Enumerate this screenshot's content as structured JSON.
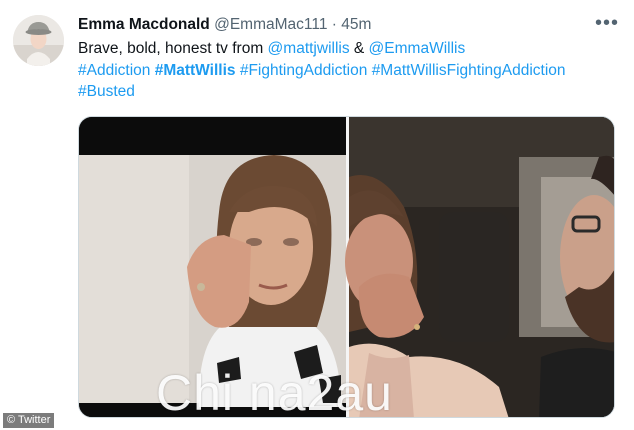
{
  "tweet": {
    "author_name": "Emma Macdonald",
    "author_handle": "@EmmaMac111",
    "separator": "·",
    "time": "45m",
    "more_glyph": "•••",
    "text_intro": "Brave, bold, honest tv from ",
    "mention_1": "@mattjwillis",
    "text_join": " & ",
    "mention_2": "@EmmaWillis",
    "hashtags": {
      "h1": "#Addiction",
      "h2": "#MattWillis",
      "h3": "#FightingAddiction",
      "h4": "#MattWillisFightingAddiction",
      "h5": "#Busted"
    }
  },
  "media": {
    "watermark_text": "Chi na2au",
    "credit_text": "© Twitter"
  },
  "colors": {
    "link": "#1d9bf0",
    "muted": "#536471",
    "text": "#0f1419"
  }
}
